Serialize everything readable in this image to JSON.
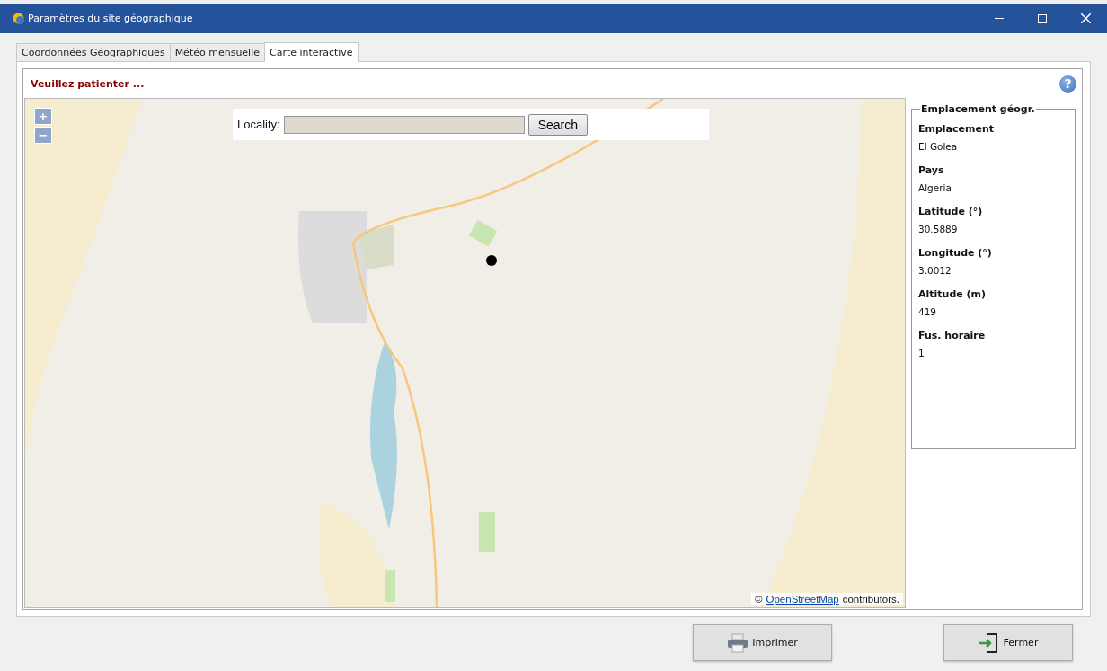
{
  "window": {
    "title": "Paramètres du site géographique"
  },
  "tabs": [
    {
      "label": "Coordonnées Géographiques",
      "selected": false
    },
    {
      "label": "Météo mensuelle",
      "selected": false
    },
    {
      "label": "Carte interactive",
      "selected": true
    }
  ],
  "status": "Veuillez patienter ...",
  "help": "?",
  "map": {
    "zoom_in": "+",
    "zoom_out": "−",
    "search": {
      "label": "Locality:",
      "button": "Search"
    },
    "attribution": {
      "prefix": "©",
      "link": "OpenStreetMap",
      "suffix": "contributors."
    }
  },
  "panel": {
    "title": "Emplacement géogr.",
    "fields": [
      {
        "label": "Emplacement",
        "value": "El Golea"
      },
      {
        "label": "Pays",
        "value": "Algeria"
      },
      {
        "label": "Latitude (°)",
        "value": "30.5889"
      },
      {
        "label": "Longitude (°)",
        "value": "3.0012"
      },
      {
        "label": "Altitude (m)",
        "value": "419"
      },
      {
        "label": "Fus. horaire",
        "value": "1"
      }
    ]
  },
  "buttons": [
    {
      "label": "Imprimer",
      "kind": "print"
    },
    {
      "label": "Fermer",
      "kind": "close"
    }
  ]
}
